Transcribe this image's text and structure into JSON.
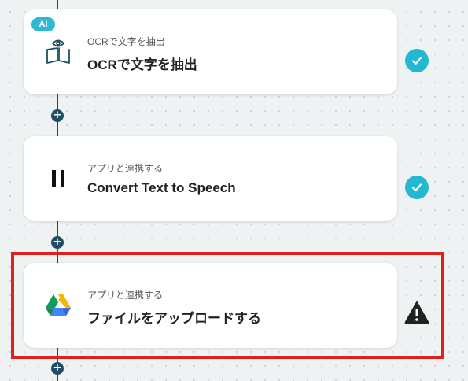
{
  "steps": [
    {
      "badge": "AI",
      "subtitle": "OCRで文字を抽出",
      "title": "OCRで文字を抽出",
      "icon": "book-eye-icon",
      "status": "completed"
    },
    {
      "subtitle": "アプリと連携する",
      "title": "Convert Text to Speech",
      "icon": "pause-bars-icon",
      "status": "completed"
    },
    {
      "subtitle": "アプリと連携する",
      "title": "ファイルをアップロードする",
      "icon": "google-drive-icon",
      "status": "warning"
    }
  ],
  "add_button_symbol": "+",
  "colors": {
    "line": "#1d4e63",
    "check": "#22b8d2",
    "highlight": "#e0201e",
    "ai_badge": "#2fb8d6"
  }
}
